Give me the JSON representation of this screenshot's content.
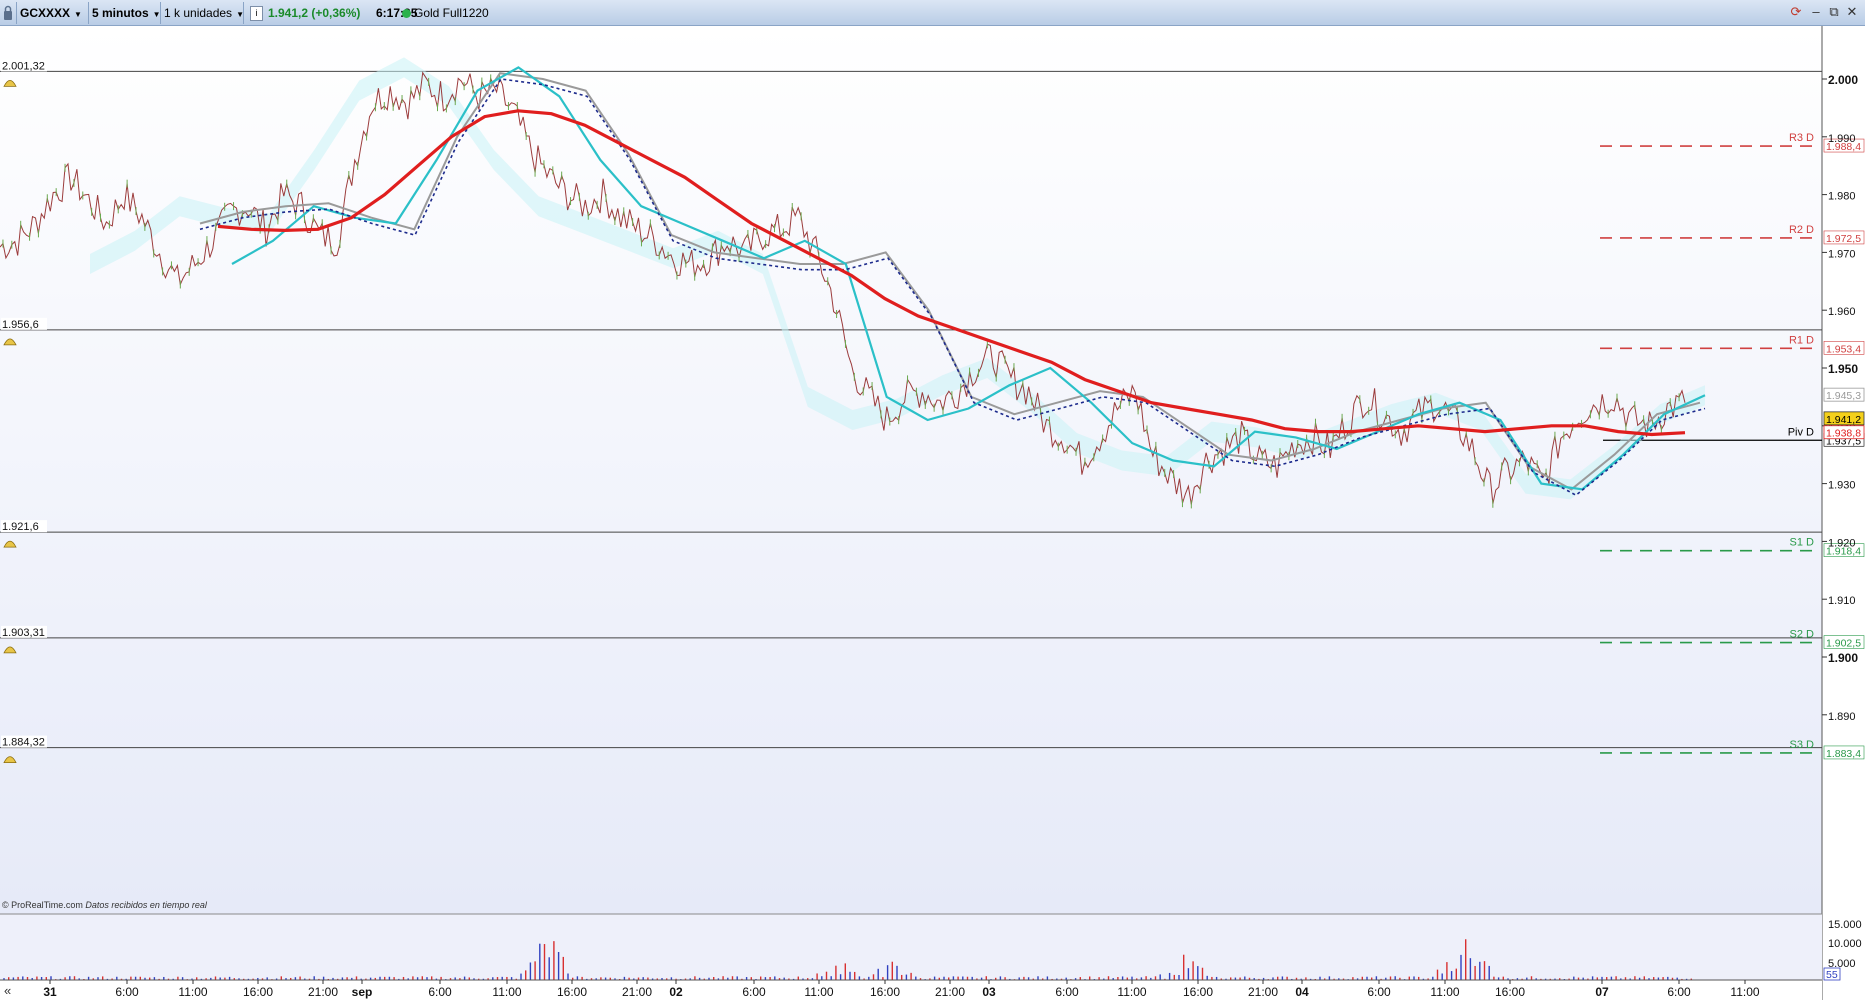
{
  "toolbar": {
    "symbol": "GCXXXX",
    "interval": "5 minutos",
    "units": "1 k unidades",
    "info_icon": "info-icon",
    "price_change": "1.941,2 (+0,36%)",
    "time": "6:17:35",
    "instrument": "Gold Full1220",
    "status_color": "#2bb24c",
    "refresh_icon": "refresh-icon",
    "minimize": "–",
    "restore": "⧉",
    "close": "✕"
  },
  "colors": {
    "price": "#8b1a1a",
    "price_green": "#6aa84f",
    "ma_slow": "#e01e1e",
    "ma_fast": "#2bc0c8",
    "ma_gray": "#9a9a9a",
    "dotted": "#1c2a8c",
    "resistance": "#d04040",
    "support": "#2a9a4a",
    "cloud": "#c8f2f6"
  },
  "chart_data": {
    "type": "line",
    "title": "",
    "y_axis_ticks": [
      1890,
      1900,
      1910,
      1920,
      1930,
      1940,
      1950,
      1960,
      1970,
      1980,
      1990,
      2000
    ],
    "y_tick_labels": [
      "1.890",
      "1.900",
      "1.910",
      "1.920",
      "1.930",
      "1.940",
      "1.950",
      "1.960",
      "1.970",
      "1.980",
      "1.990",
      "2.000"
    ],
    "y_bold_ticks": [
      "1.900",
      "1.950",
      "2.000"
    ],
    "ylim": [
      1884.32,
      2001.32
    ],
    "alert_lines": [
      {
        "value": 2001.32,
        "label": "2.001,32"
      },
      {
        "value": 1956.6,
        "label": "1.956,6"
      },
      {
        "value": 1921.6,
        "label": "1.921,6"
      },
      {
        "value": 1903.31,
        "label": "1.903,31"
      },
      {
        "value": 1884.32,
        "label": "1.884,32"
      }
    ],
    "pivot_levels": [
      {
        "name": "R3 D",
        "value": 1988.4,
        "label": "1.988,4",
        "kind": "resistance"
      },
      {
        "name": "R2 D",
        "value": 1972.5,
        "label": "1.972,5",
        "kind": "resistance"
      },
      {
        "name": "R1 D",
        "value": 1953.4,
        "label": "1.953,4",
        "kind": "resistance"
      },
      {
        "name": "Piv D",
        "value": 1937.5,
        "label": "1.937,5",
        "kind": "pivot"
      },
      {
        "name": "S1 D",
        "value": 1918.4,
        "label": "1.918,4",
        "kind": "support"
      },
      {
        "name": "S2 D",
        "value": 1902.5,
        "label": "1.902,5",
        "kind": "support"
      },
      {
        "name": "S3 D",
        "value": 1883.4,
        "label": "1.883,4",
        "kind": "support"
      }
    ],
    "price_tags": [
      {
        "value": 1945.3,
        "label": "1.945,3",
        "kind": "muted"
      },
      {
        "value": 1941.2,
        "label": "1.941,2",
        "kind": "current"
      },
      {
        "value": 1938.8,
        "label": "1.938,8",
        "kind": "ma"
      }
    ],
    "x_labels": [
      {
        "label": "31",
        "bold": true
      },
      {
        "label": "6:00"
      },
      {
        "label": "11:00"
      },
      {
        "label": "16:00"
      },
      {
        "label": "21:00"
      },
      {
        "label": "sep",
        "bold": true
      },
      {
        "label": "6:00"
      },
      {
        "label": "11:00"
      },
      {
        "label": "16:00"
      },
      {
        "label": "21:00"
      },
      {
        "label": "02",
        "bold": true
      },
      {
        "label": "6:00"
      },
      {
        "label": "11:00"
      },
      {
        "label": "16:00"
      },
      {
        "label": "21:00"
      },
      {
        "label": "03",
        "bold": true
      },
      {
        "label": "6:00"
      },
      {
        "label": "11:00"
      },
      {
        "label": "16:00"
      },
      {
        "label": "21:00"
      },
      {
        "label": "04",
        "bold": true
      },
      {
        "label": "6:00"
      },
      {
        "label": "11:00"
      },
      {
        "label": "16:00"
      },
      {
        "label": "07",
        "bold": true
      },
      {
        "label": "6:00"
      },
      {
        "label": "11:00"
      }
    ],
    "price_series": [
      1971,
      1972,
      1975,
      1980,
      1983,
      1979,
      1975,
      1980,
      1976,
      1970,
      1965,
      1968,
      1972,
      1977,
      1978,
      1974,
      1980,
      1978,
      1973,
      1972,
      1986,
      1996,
      1998,
      1996,
      1999,
      1997,
      2000,
      1997,
      1998,
      1994,
      1987,
      1983,
      1980,
      1978,
      1980,
      1976,
      1974,
      1972,
      1969,
      1968,
      1969,
      1972,
      1970,
      1973,
      1974,
      1976,
      1970,
      1962,
      1950,
      1945,
      1941,
      1945,
      1946,
      1944,
      1946,
      1950,
      1952,
      1948,
      1946,
      1940,
      1938,
      1934,
      1938,
      1943,
      1946,
      1935,
      1931,
      1928,
      1934,
      1936,
      1938,
      1934,
      1933,
      1937,
      1938,
      1936,
      1941,
      1945,
      1942,
      1939,
      1942,
      1944,
      1941,
      1936,
      1929,
      1932,
      1934,
      1930,
      1938,
      1942,
      1944,
      1945,
      1941,
      1940,
      1943,
      1944
    ],
    "ma_slow_series": [
      1974.5,
      1974,
      1973.8,
      1974,
      1976,
      1980,
      1985,
      1990,
      1993.5,
      1994.5,
      1994,
      1992,
      1989,
      1986,
      1983,
      1979,
      1975,
      1972,
      1969,
      1966,
      1962,
      1959,
      1957,
      1955,
      1953,
      1951,
      1948,
      1946,
      1944,
      1943,
      1942,
      1941,
      1939.5,
      1939,
      1939,
      1939.5,
      1940,
      1939.5,
      1939,
      1939.5,
      1940,
      1940,
      1939,
      1938.5,
      1938.8
    ],
    "ma_fast_series": [
      1968,
      1972,
      1978,
      1976,
      1975,
      1986,
      1998,
      2002,
      1997,
      1986,
      1978,
      1975,
      1972,
      1969,
      1972,
      1968,
      1945,
      1941,
      1943,
      1947,
      1950,
      1944,
      1937,
      1934,
      1933,
      1939,
      1938,
      1936,
      1939,
      1942,
      1944,
      1941,
      1930,
      1929,
      1935,
      1942,
      1945.3
    ],
    "ma_gray_series": [
      1975,
      1977,
      1978,
      1978.5,
      1976,
      1974,
      1990,
      2001,
      2000,
      1998,
      1987,
      1973,
      1970,
      1969,
      1968,
      1968,
      1970,
      1960,
      1945,
      1942,
      1944,
      1946,
      1945,
      1940,
      1935,
      1934,
      1936,
      1939,
      1941,
      1943,
      1944,
      1933,
      1929,
      1935,
      1942,
      1944
    ],
    "volume_axis": [
      "15.000",
      "10.000",
      "5.000",
      "55"
    ],
    "volume_spikes": [
      {
        "x": 0.3,
        "v": 14000
      },
      {
        "x": 0.3,
        "v": 9000
      },
      {
        "x": 0.46,
        "v": 6000
      },
      {
        "x": 0.49,
        "v": 5500
      },
      {
        "x": 0.65,
        "v": 9000
      },
      {
        "x": 0.8,
        "v": 11000
      },
      {
        "x": 0.81,
        "v": 9500
      }
    ]
  },
  "footer": {
    "credit": "© ProRealTime.com",
    "credit_italic": "Datos recibidos en tiempo real",
    "scroll_icon": "«"
  }
}
